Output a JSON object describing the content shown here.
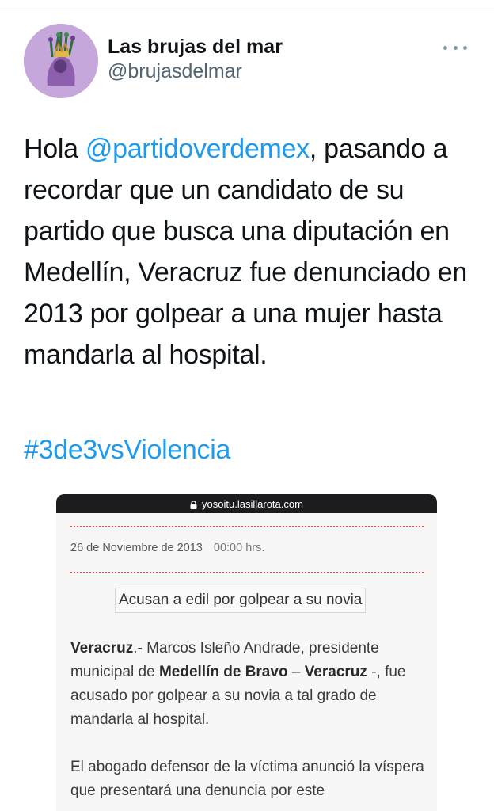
{
  "tweet": {
    "display_name": "Las brujas del mar",
    "handle": "@brujasdelmar",
    "text_before": "Hola ",
    "mention": "@partidoverdemex",
    "text_after": ", pasando a recordar que un candidato de su partido que busca una diputación en Medellín, Veracruz fue denunciado en 2013 por golpear a una mujer hasta mandarla al hospital.",
    "hashtag": "#3de3vsViolencia"
  },
  "card": {
    "url": "yosoitu.lasillarota.com",
    "date": "26 de Noviembre de 2013",
    "time": "00:00 hrs.",
    "headline": "Acusan a edil por golpear a su novia",
    "p1": {
      "b1": "Veracruz",
      "t1": ".- Marcos Isleño Andrade, presidente municipal de ",
      "b2": "Medellín de Bravo",
      "t2": " – ",
      "b3": "Veracruz",
      "t3": " -, fue acusado por golpear a su novia a tal grado de mandarla al hospital."
    },
    "p2": "El abogado defensor de la víctima anunció la víspera que presentará una denuncia por este"
  },
  "colors": {
    "link": "#1d9bf0",
    "avatar_bg": "#c6a7dc",
    "card_bar": "#1c1c1e",
    "dotted_rule": "#d9534f"
  },
  "icons": [
    "more-icon",
    "lock-icon"
  ]
}
